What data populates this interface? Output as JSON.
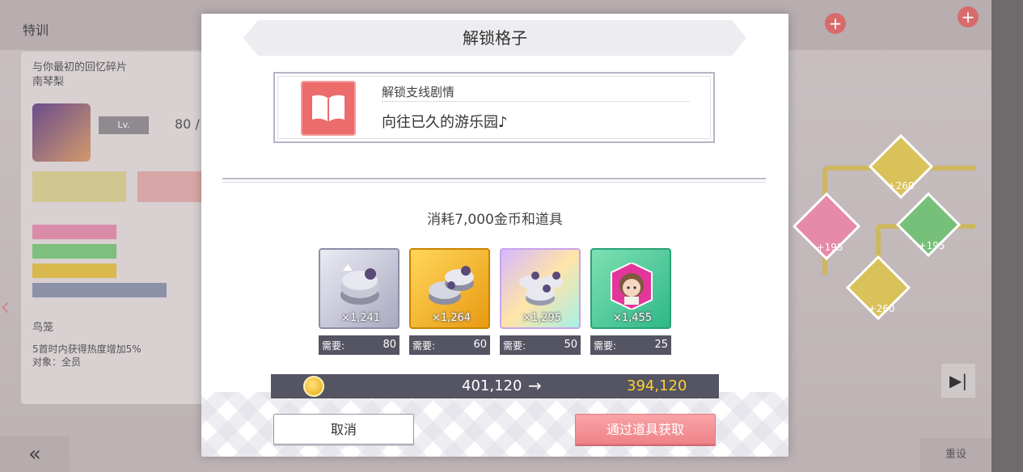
{
  "background": {
    "screen_title": "特训",
    "card_line1": "与你最初的回忆碎片",
    "card_line2": "南琴梨",
    "level_label": "Lv.",
    "level_value": "80 /",
    "skill_name": "鸟笼",
    "skill_desc_1": "5首时内获得热度增加5%",
    "skill_desc_2": "对象：全员",
    "back_glyph": "«",
    "bottom_right_label": "重设",
    "skip_glyph": "▶|",
    "node_values": [
      "+260",
      "+195",
      "+195",
      "+260"
    ]
  },
  "dialog": {
    "title": "解锁格子",
    "unlock_label": "解锁支线剧情",
    "unlock_story": "向往已久的游乐园♪",
    "cost_text": "消耗7,000金币和道具",
    "items": [
      {
        "count": "×1,241",
        "need_label": "需要:",
        "need": "80",
        "icon": "silver-macaron-icon"
      },
      {
        "count": "×1,264",
        "need_label": "需要:",
        "need": "60",
        "icon": "gold-macaron-icon"
      },
      {
        "count": "×1,295",
        "need_label": "需要:",
        "need": "50",
        "icon": "rainbow-macaron-icon"
      },
      {
        "count": "×1,455",
        "need_label": "需要:",
        "need": "25",
        "icon": "character-memento-icon"
      }
    ],
    "coins_from": "401,120",
    "coins_arrow": "→",
    "coins_to": "394,120",
    "cancel_label": "取消",
    "get_label": "通过道具获取"
  },
  "colors": {
    "accent_pink": "#ee8389",
    "coin_gold": "#ffd233",
    "bar_dark": "#545463"
  }
}
